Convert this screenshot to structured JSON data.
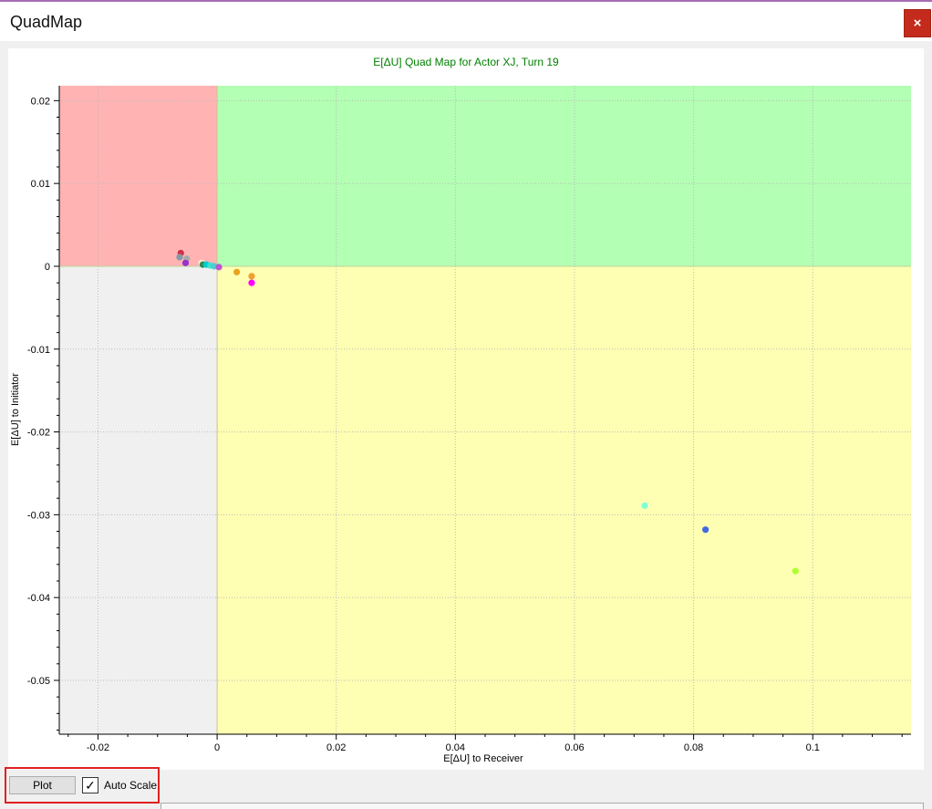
{
  "window": {
    "title": "QuadMap",
    "close_symbol": "×"
  },
  "chart_data": {
    "type": "scatter",
    "title": "E[ΔU] Quad Map for Actor XJ, Turn 19",
    "xlabel": "E[ΔU] to Receiver",
    "ylabel": "E[ΔU] to Initiator",
    "xlim": [
      -0.0265,
      0.1165
    ],
    "ylim": [
      -0.0565,
      0.0218
    ],
    "xticks": [
      -0.02,
      0,
      0.02,
      0.04,
      0.06,
      0.08,
      0.1
    ],
    "xtick_labels": [
      "-0.02",
      "0",
      "0.02",
      "0.04",
      "0.06",
      "0.08",
      "0.1"
    ],
    "yticks": [
      0.02,
      0.01,
      0,
      -0.01,
      -0.02,
      -0.03,
      -0.04,
      -0.05
    ],
    "ytick_labels": [
      "0.02",
      "0.01",
      "0",
      "-0.01",
      "-0.02",
      "-0.03",
      "-0.04",
      "-0.05"
    ],
    "grid": true,
    "quadrant_colors": {
      "top_left": "#ffb3b3",
      "top_right": "#b3ffb3",
      "bottom_left": "#f0f0f0",
      "bottom_right": "#ffffb3"
    },
    "colors": {
      "title": "#008000"
    },
    "points": [
      {
        "x": -0.0061,
        "y": 0.0016,
        "color": "#d22f4a"
      },
      {
        "x": -0.0063,
        "y": 0.0011,
        "color": "#7f9aa8"
      },
      {
        "x": -0.0051,
        "y": 0.0009,
        "color": "#a9a9a9"
      },
      {
        "x": -0.0053,
        "y": 0.0004,
        "color": "#9932cc"
      },
      {
        "x": -0.0026,
        "y": 0.0004,
        "color": "#fff0d2"
      },
      {
        "x": -0.0024,
        "y": 0.0002,
        "color": "#2e8b57"
      },
      {
        "x": -0.0018,
        "y": 0.0002,
        "color": "#00ced1"
      },
      {
        "x": -0.0011,
        "y": 0.0001,
        "color": "#40e0d0"
      },
      {
        "x": -0.0005,
        "y": 0.0,
        "color": "#48d1cc"
      },
      {
        "x": 0.0003,
        "y": -0.0001,
        "color": "#ba55d3"
      },
      {
        "x": 0.0033,
        "y": -0.0007,
        "color": "#e8a317"
      },
      {
        "x": 0.0058,
        "y": -0.0012,
        "color": "#f0a030"
      },
      {
        "x": 0.0058,
        "y": -0.002,
        "color": "#ff00ff"
      },
      {
        "x": 0.0718,
        "y": -0.0289,
        "color": "#7fffd4"
      },
      {
        "x": 0.082,
        "y": -0.0318,
        "color": "#4169e1"
      },
      {
        "x": 0.0971,
        "y": -0.0368,
        "color": "#adff2f"
      }
    ]
  },
  "controls": {
    "plot_label": "Plot",
    "autoscale_label": "Auto Scale",
    "autoscale_checked": true,
    "check_symbol": "✓"
  }
}
